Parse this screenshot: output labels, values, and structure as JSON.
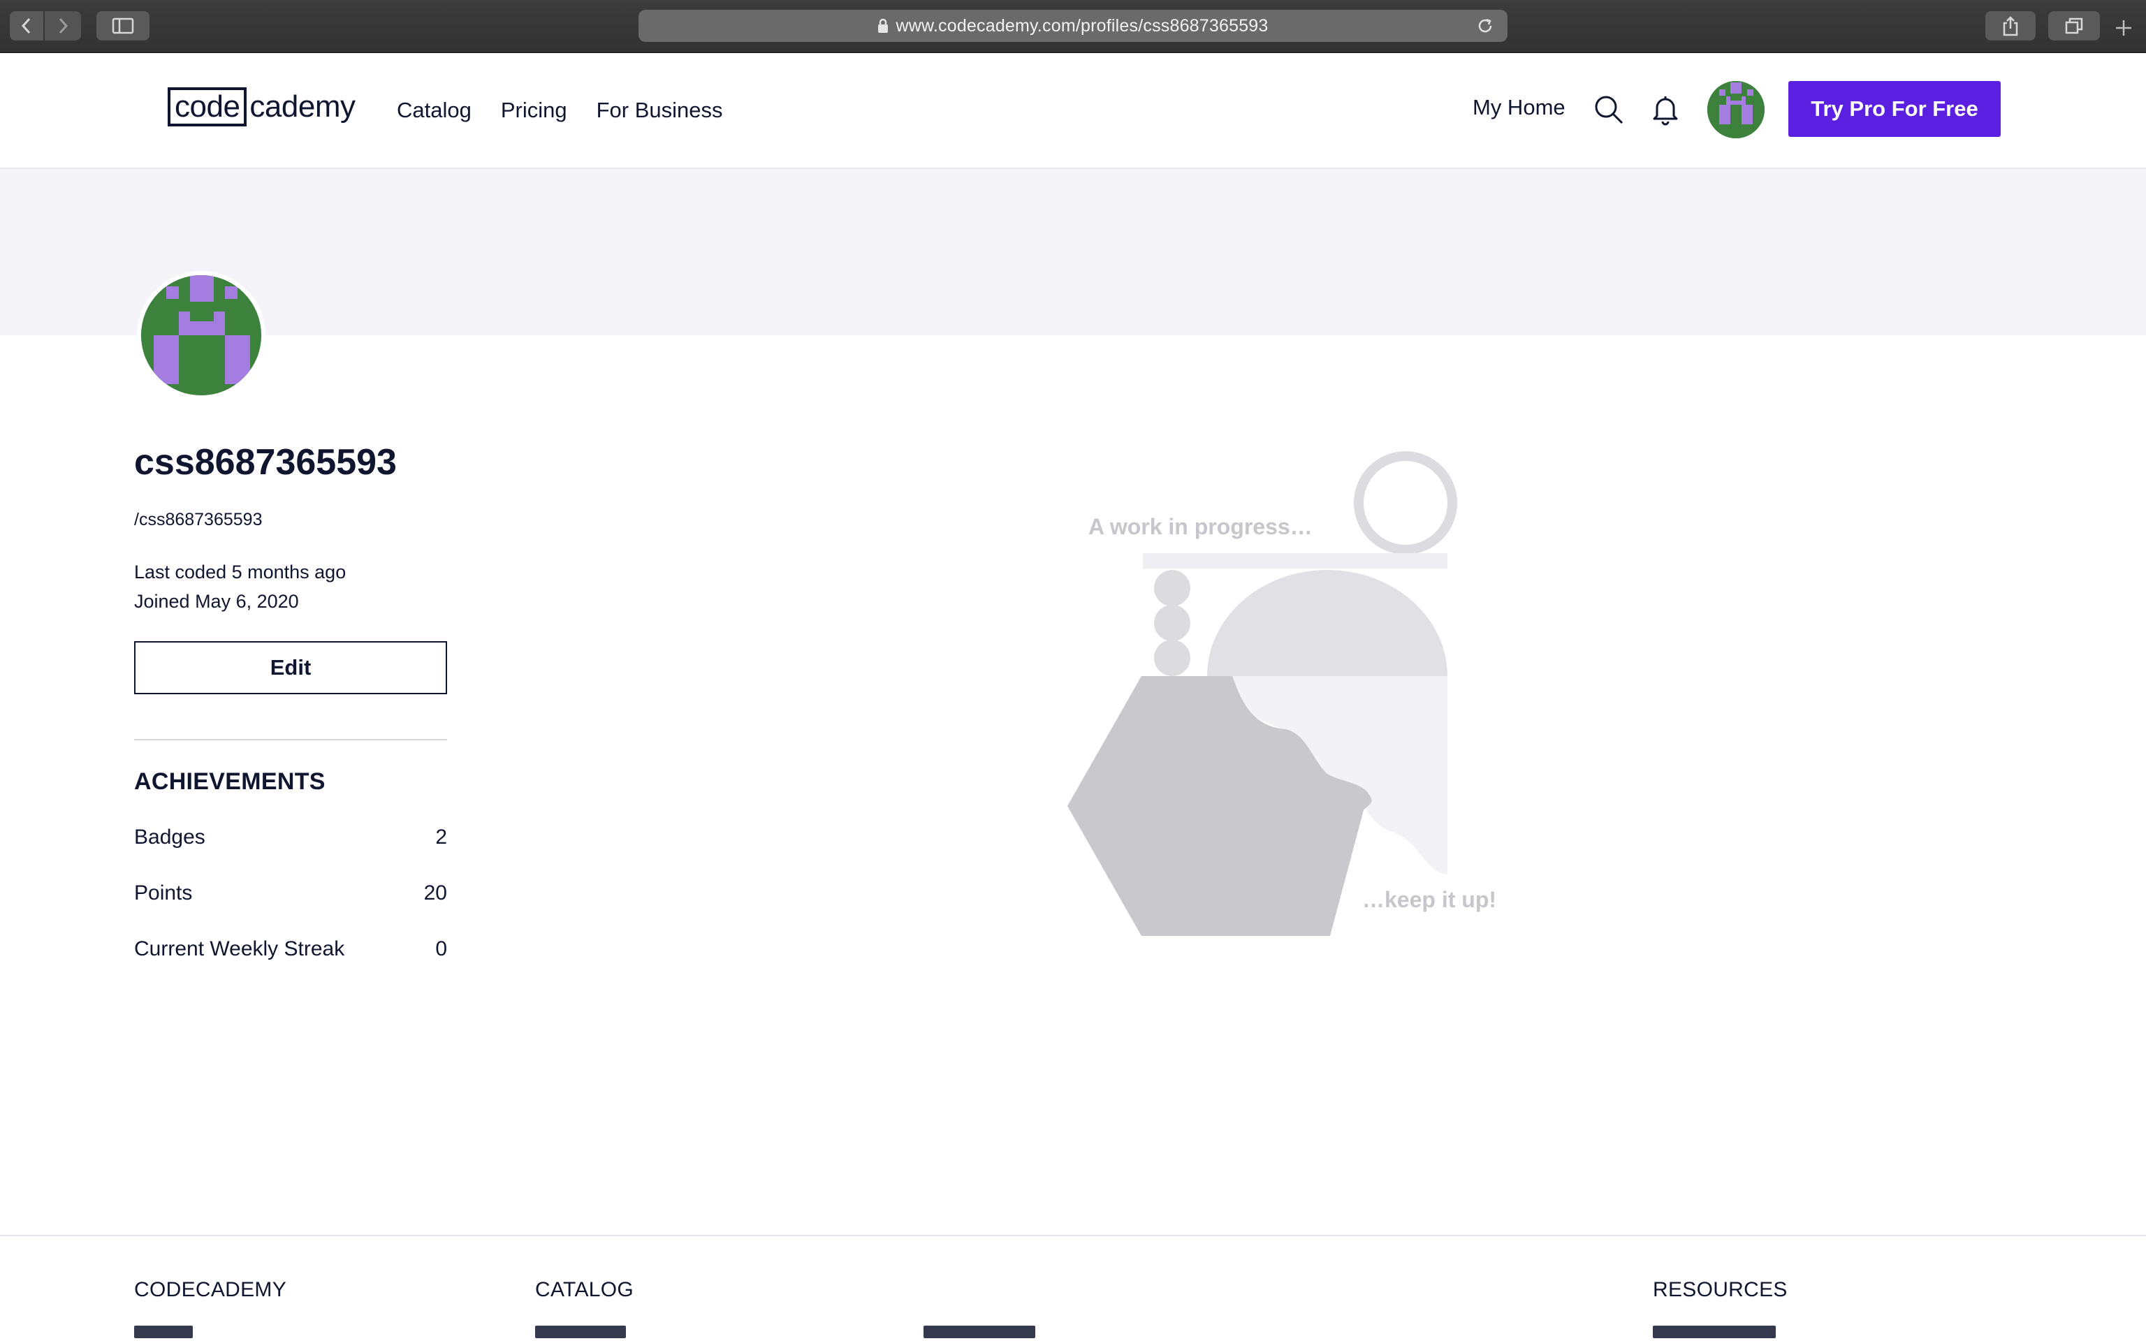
{
  "browser": {
    "url": "www.codecademy.com/profiles/css8687365593"
  },
  "header": {
    "logo_part1": "code",
    "logo_part2": "cademy",
    "nav": [
      "Catalog",
      "Pricing",
      "For Business"
    ],
    "my_home": "My Home",
    "cta": "Try Pro For Free"
  },
  "profile": {
    "username": "css8687365593",
    "handle": "/css8687365593",
    "last_coded": "Last coded 5 months ago",
    "joined": "Joined May 6, 2020",
    "edit_label": "Edit",
    "avatar_colors": {
      "background": "#3c823c",
      "pixels": "#a57de0"
    }
  },
  "achievements": {
    "title": "ACHIEVEMENTS",
    "rows": [
      {
        "label": "Badges",
        "value": "2"
      },
      {
        "label": "Points",
        "value": "20"
      },
      {
        "label": "Current Weekly Streak",
        "value": "0"
      }
    ]
  },
  "illustration": {
    "top_text": "A work in progress…",
    "bottom_text": "…keep it up!"
  },
  "footer": {
    "columns": [
      "CODECADEMY",
      "CATALOG",
      "RESOURCES"
    ]
  },
  "colors": {
    "brand_purple": "#5a1fe0",
    "text_navy": "#10162f",
    "banner": "#f5f5f9"
  }
}
